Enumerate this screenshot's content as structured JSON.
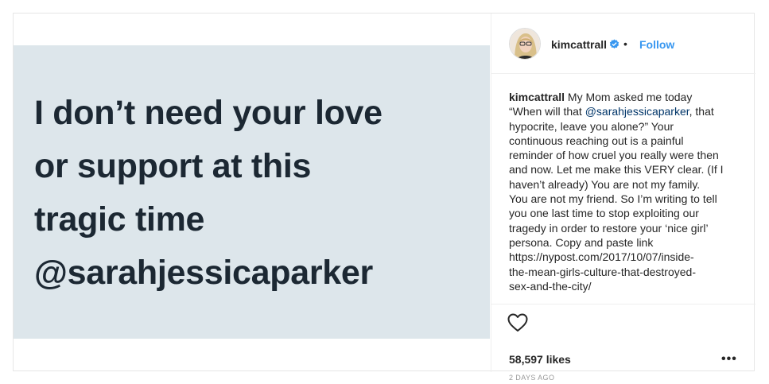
{
  "post": {
    "image_text_lines": [
      "I don’t need your love",
      "or support at this",
      "tragic time",
      "@sarahjessicaparker"
    ]
  },
  "header": {
    "username": "kimcattrall",
    "separator": "•",
    "follow_label": "Follow"
  },
  "caption": {
    "username": "kimcattrall",
    "line1_rest": " My Mom asked me today",
    "line2_pre": "“When will that ",
    "line2_mention": "@sarahjessicaparker",
    "line2_post": ", that",
    "lines": [
      "hypocrite, leave you alone?” Your",
      "continuous reaching out is a painful",
      "reminder of how cruel you really were then",
      "and now. Let me make this VERY clear. (If I",
      "haven’t already) You are not my family.",
      "You are not my friend. So I’m writing to tell",
      "you one last time to stop exploiting our",
      "tragedy in order to restore your ‘nice girl’",
      "persona. Copy and paste link",
      "https://nypost.com/2017/10/07/inside-",
      "the-mean-girls-culture-that-destroyed-",
      "sex-and-the-city/"
    ]
  },
  "footer": {
    "likes": "58,597 likes",
    "more": "•••",
    "timestamp": "2 DAYS AGO"
  },
  "colors": {
    "media_bg": "#dde6eb",
    "media_text": "#1c2833",
    "follow": "#3897f0",
    "verified": "#3897f0"
  },
  "icons": [
    "avatar",
    "verified-badge-icon",
    "heart-icon",
    "more-options-icon"
  ]
}
